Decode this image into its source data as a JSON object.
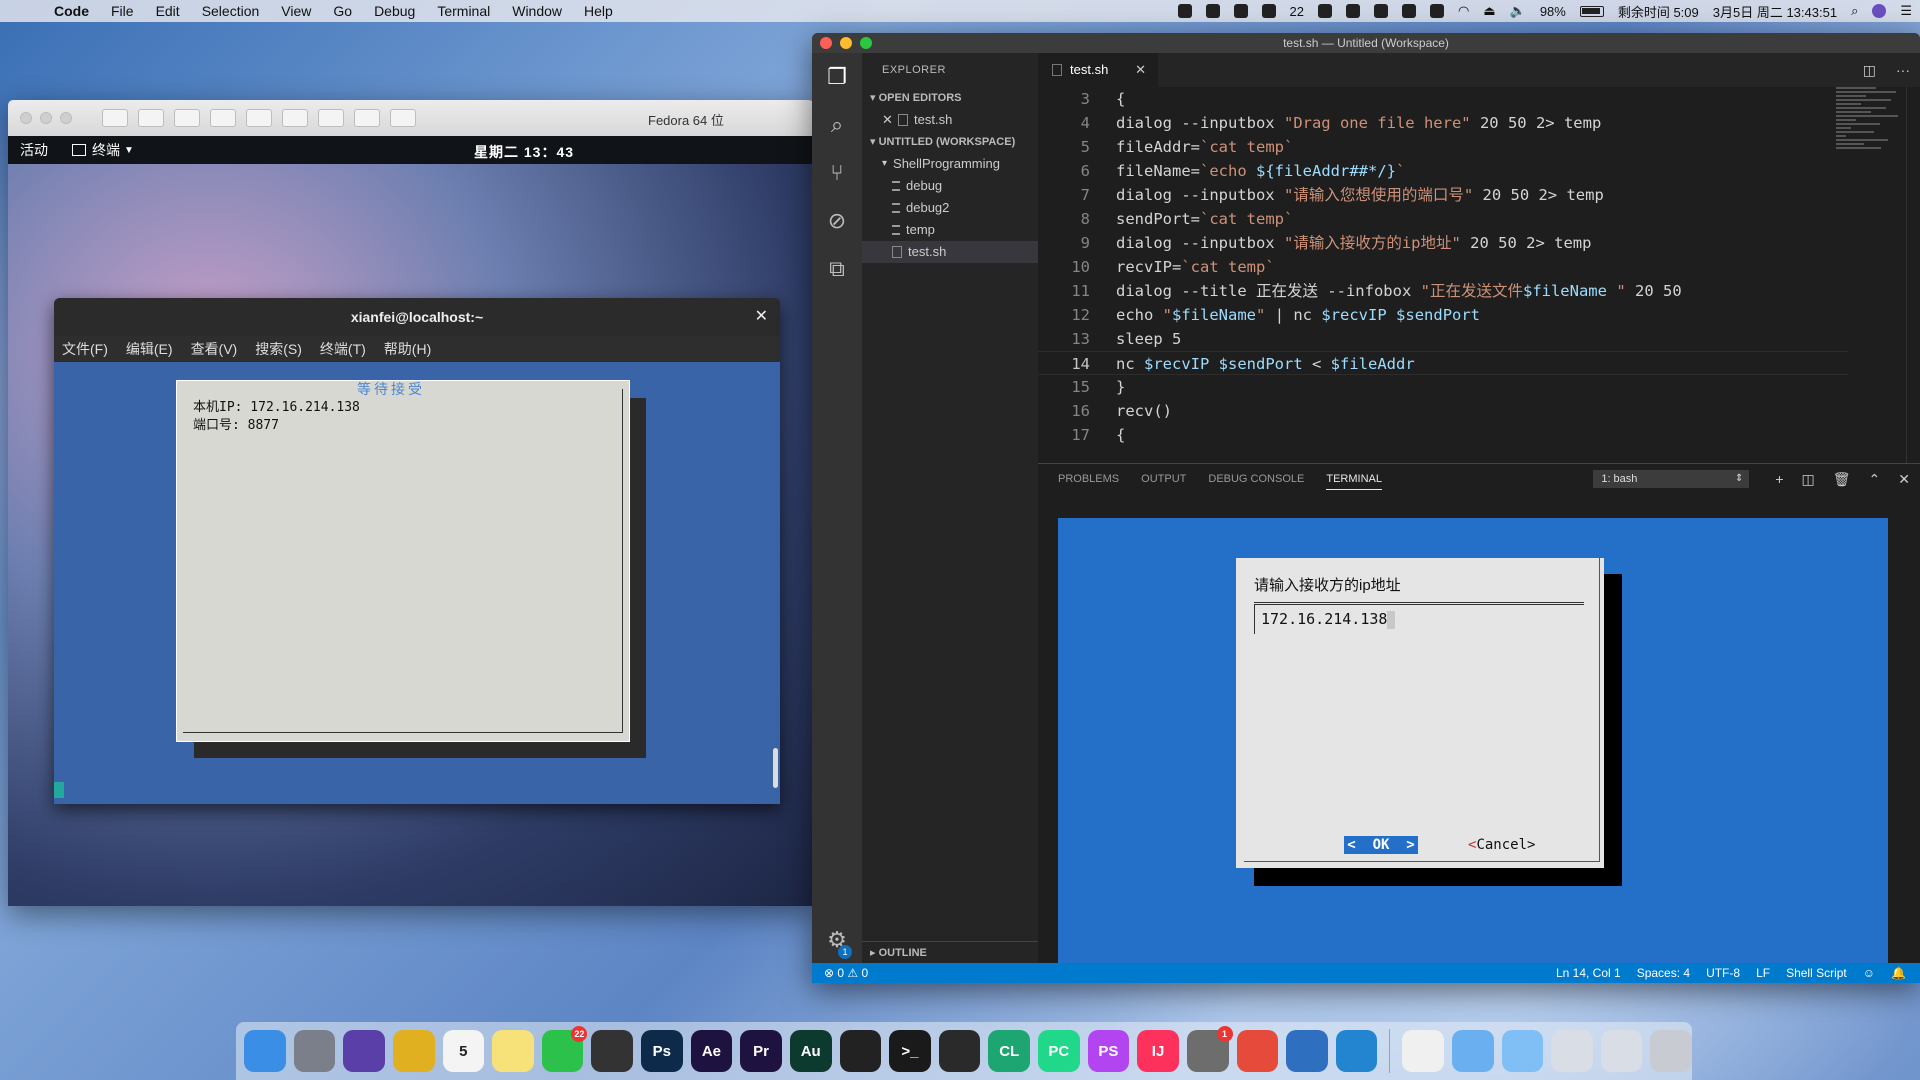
{
  "menubar": {
    "app": "Code",
    "items": [
      "File",
      "Edit",
      "Selection",
      "View",
      "Go",
      "Debug",
      "Terminal",
      "Window",
      "Help"
    ],
    "wechat_count": "22",
    "battery": "98%",
    "remaining": "剩余时间 5:09",
    "datetime": "3月5日 周二  13:43:51"
  },
  "vm": {
    "title": "Fedora 64 位",
    "activities": "活动",
    "terminal_menu": "终端",
    "clock": "星期二 13：43"
  },
  "gnome_terminal": {
    "title": "xianfei@localhost:~",
    "menu": [
      "文件(F)",
      "编辑(E)",
      "查看(V)",
      "搜索(S)",
      "终端(T)",
      "帮助(H)"
    ],
    "dialog_title": "等待接受",
    "dialog_lines": [
      "本机IP: 172.16.214.138",
      "端口号: 8877"
    ]
  },
  "vscode": {
    "window_title": "test.sh — Untitled (Workspace)",
    "explorer_label": "EXPLORER",
    "open_editors_label": "OPEN EDITORS",
    "open_editor_file": "test.sh",
    "workspace_label": "UNTITLED (WORKSPACE)",
    "folder": "ShellProgramming",
    "files": [
      "debug",
      "debug2",
      "temp",
      "test.sh"
    ],
    "outline_label": "OUTLINE",
    "tab": "test.sh",
    "code": [
      {
        "n": "3",
        "t": "{"
      },
      {
        "n": "4",
        "t": "dialog --inputbox \"Drag one file here\" 20 50 2> temp"
      },
      {
        "n": "5",
        "t": "fileAddr=`cat temp`"
      },
      {
        "n": "6",
        "t": "fileName=`echo ${fileAddr##*/}`"
      },
      {
        "n": "7",
        "t": "dialog --inputbox \"请输入您想使用的端口号\" 20 50 2> temp"
      },
      {
        "n": "8",
        "t": "sendPort=`cat temp`"
      },
      {
        "n": "9",
        "t": "dialog --inputbox \"请输入接收方的ip地址\" 20 50 2> temp"
      },
      {
        "n": "10",
        "t": "recvIP=`cat temp`"
      },
      {
        "n": "11",
        "t": "dialog --title 正在发送 --infobox \"正在发送文件$fileName \" 20 50"
      },
      {
        "n": "12",
        "t": "echo \"$fileName\" | nc $recvIP $sendPort"
      },
      {
        "n": "13",
        "t": "sleep 5"
      },
      {
        "n": "14",
        "t": "nc $recvIP $sendPort < $fileAddr"
      },
      {
        "n": "15",
        "t": "}"
      },
      {
        "n": "16",
        "t": "recv()"
      },
      {
        "n": "17",
        "t": "{"
      }
    ],
    "current_line": "14",
    "panel_tabs": [
      "PROBLEMS",
      "OUTPUT",
      "DEBUG CONSOLE",
      "TERMINAL"
    ],
    "active_panel_tab": "TERMINAL",
    "terminal_select": "1: bash",
    "dialog": {
      "prompt": "请输入接收方的ip地址",
      "input_value": "172.16.214.138",
      "ok": "<  OK  >",
      "cancel_lt": "<",
      "cancel": "Cancel>"
    },
    "status": {
      "errors": "0",
      "warnings": "0",
      "position": "Ln 14, Col 1",
      "spaces": "Spaces: 4",
      "encoding": "UTF-8",
      "eol": "LF",
      "language": "Shell Script"
    },
    "settings_badge": "1"
  },
  "dock": {
    "calendar_day": "5",
    "wechat_badge": "22",
    "settings_badge": "1",
    "apps": [
      {
        "name": "finder",
        "label": "",
        "color": "#3a8ee6"
      },
      {
        "name": "launchpad",
        "label": "",
        "color": "#7a7f8a"
      },
      {
        "name": "siri",
        "label": "",
        "color": "#5a3fa8"
      },
      {
        "name": "chrome",
        "label": "",
        "color": "#e0b020"
      },
      {
        "name": "calendar",
        "label": "5",
        "color": "#f4f4f4"
      },
      {
        "name": "notes",
        "label": "",
        "color": "#f7e27a"
      },
      {
        "name": "wechat",
        "label": "",
        "color": "#2cc14a"
      },
      {
        "name": "final-cut",
        "label": "",
        "color": "#333"
      },
      {
        "name": "photoshop",
        "label": "Ps",
        "color": "#0d2a4a"
      },
      {
        "name": "after-effects",
        "label": "Ae",
        "color": "#1e1240"
      },
      {
        "name": "premiere",
        "label": "Pr",
        "color": "#1e1240"
      },
      {
        "name": "audition",
        "label": "Au",
        "color": "#0d3a2e"
      },
      {
        "name": "qq",
        "label": "",
        "color": "#222"
      },
      {
        "name": "terminal",
        "label": ">_",
        "color": "#1a1a1a"
      },
      {
        "name": "activity-monitor",
        "label": "",
        "color": "#2a2a2a"
      },
      {
        "name": "clion",
        "label": "CL",
        "color": "#1ea672"
      },
      {
        "name": "pycharm",
        "label": "PC",
        "color": "#21d789"
      },
      {
        "name": "phpstorm",
        "label": "PS",
        "color": "#b345f1"
      },
      {
        "name": "intellij",
        "label": "IJ",
        "color": "#fe315d"
      },
      {
        "name": "system-preferences",
        "label": "",
        "color": "#6d6d6d"
      },
      {
        "name": "screen-record",
        "label": "",
        "color": "#e54a3a"
      },
      {
        "name": "vmware",
        "label": "",
        "color": "#2f6fc0"
      },
      {
        "name": "vscode",
        "label": "",
        "color": "#2385cf"
      },
      {
        "name": "document",
        "label": "",
        "color": "#f0f0f0"
      },
      {
        "name": "folder-apps",
        "label": "",
        "color": "#6ab0f0"
      },
      {
        "name": "folder",
        "label": "",
        "color": "#7fbff5"
      },
      {
        "name": "screenshot",
        "label": "",
        "color": "#d8dde6"
      },
      {
        "name": "preview",
        "label": "",
        "color": "#d8dde6"
      },
      {
        "name": "trash",
        "label": "",
        "color": "#c8ccd2"
      }
    ]
  }
}
